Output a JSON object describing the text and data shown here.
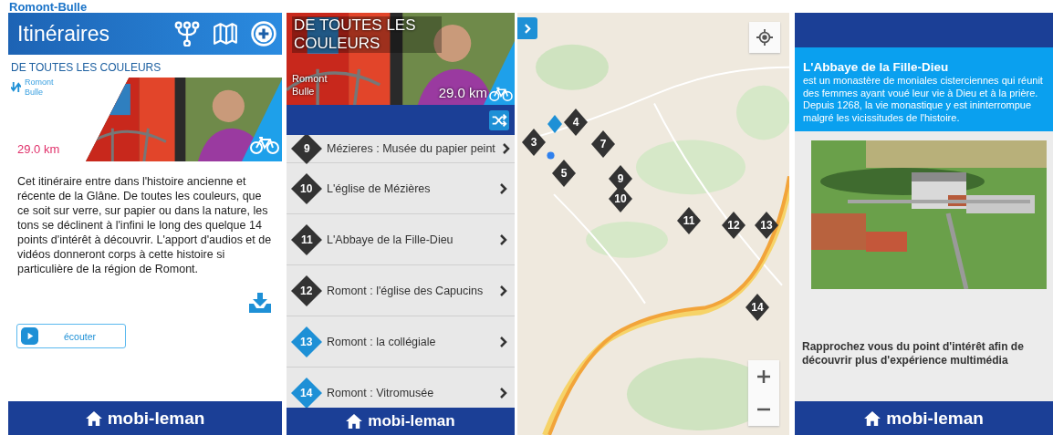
{
  "page_title": "Romont-Bulle",
  "route_screen": {
    "header_title": "Itinéraires",
    "route_title": "DE TOUTES LES COULEURS",
    "start": "Romont",
    "end": "Bulle",
    "distance": "29.0 km",
    "description": "Cet itinéraire entre dans l'histoire ancienne et récente de la Glâne. De toutes les couleurs, que ce soit sur verre, sur papier ou dans la nature, les tons se déclinent à l'infini le long des quelque 14 points d'intérêt à découvrir. L'apport d'audios et de vidéos donneront corps à cette histoire si particulière de la région de Romont.",
    "listen_button": "écouter",
    "footer": "mobi-leman"
  },
  "poi_list_screen": {
    "route_title": "DE TOUTES LES COULEURS",
    "start": "Romont",
    "end": "Bulle",
    "distance": "29.0 km",
    "items": [
      {
        "number": "9",
        "label": "Mézieres : Musée du papier peint",
        "color": "#333333"
      },
      {
        "number": "10",
        "label": "L'église de Mézières",
        "color": "#333333"
      },
      {
        "number": "11",
        "label": "L'Abbaye de la Fille-Dieu",
        "color": "#333333"
      },
      {
        "number": "12",
        "label": "Romont : l'église des Capucins",
        "color": "#333333"
      },
      {
        "number": "13",
        "label": "Romont : la collégiale",
        "color": "#1e90d6"
      },
      {
        "number": "14",
        "label": "Romont : Vitromusée",
        "color": "#1e90d6"
      }
    ],
    "footer": "mobi-leman"
  },
  "map_screen": {
    "markers": [
      {
        "color": "#1e90d6"
      },
      {
        "label": "3",
        "color": "#333333"
      },
      {
        "label": "4",
        "color": "#333333"
      },
      {
        "label": "5",
        "color": "#333333"
      },
      {
        "label": "7",
        "color": "#333333"
      },
      {
        "label": "9",
        "color": "#333333"
      },
      {
        "label": "10",
        "color": "#333333"
      },
      {
        "label": "11",
        "color": "#333333"
      },
      {
        "label": "12",
        "color": "#333333"
      },
      {
        "label": "13",
        "color": "#333333"
      },
      {
        "label": "14",
        "color": "#333333"
      }
    ]
  },
  "poi_detail_screen": {
    "title": "L'Abbaye de la Fille-Dieu",
    "description": "est un monastère de moniales cisterciennes qui réunit des femmes ayant voué leur vie à Dieu et à la prière. Depuis 1268, la vie monastique y est ininterrompue malgré les vicissitudes de l'histoire.",
    "hint": "Rapprochez vous du point d'intérêt afin de découvrir plus d'expérience multimédia",
    "footer": "mobi-leman"
  }
}
